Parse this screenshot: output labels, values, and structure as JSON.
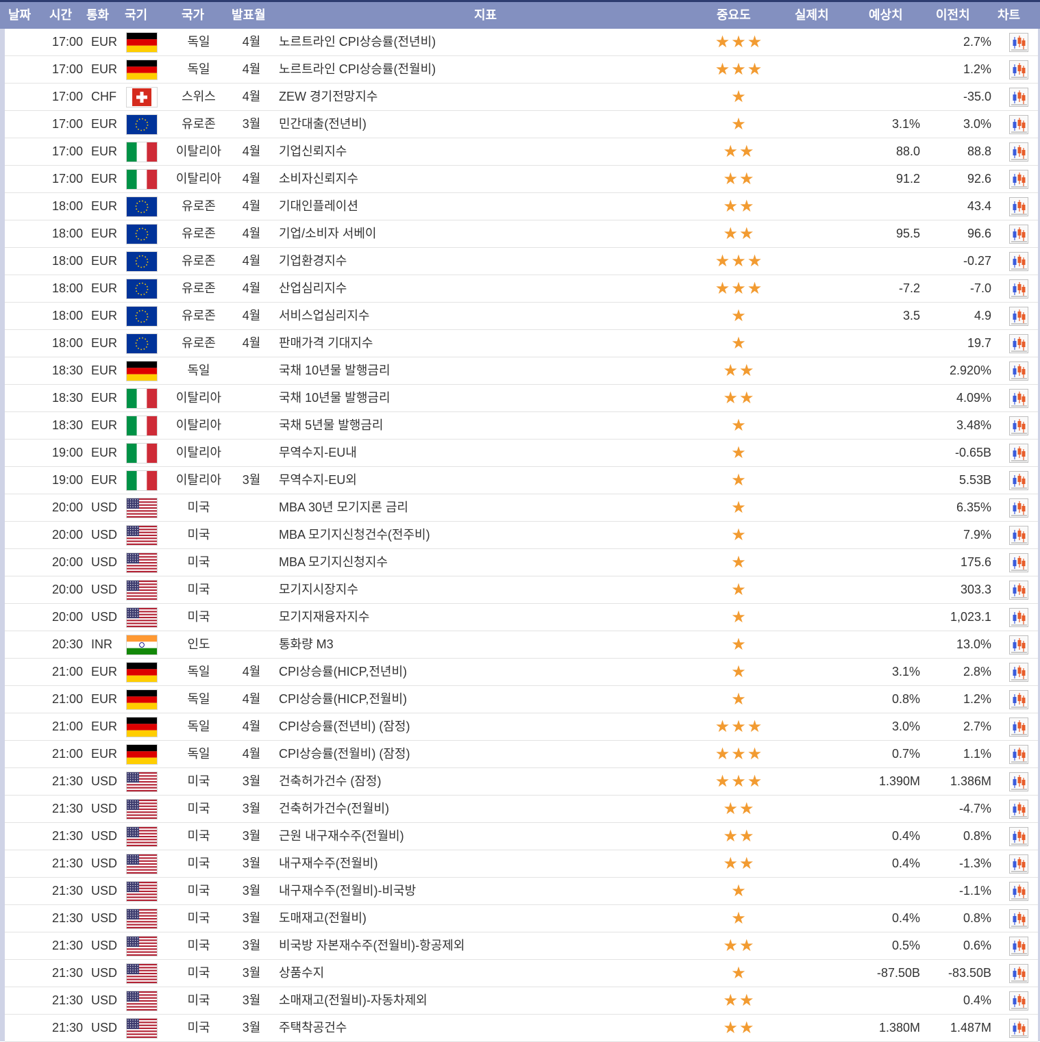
{
  "header": {
    "date": "날짜",
    "time": "시간",
    "currency": "통화",
    "flag": "국기",
    "country": "국가",
    "month": "발표월",
    "indicator": "지표",
    "importance": "중요도",
    "actual": "실제치",
    "forecast": "예상치",
    "previous": "이전치",
    "chart": "차트"
  },
  "colors": {
    "header_bg": "#8390c0",
    "header_rule": "#2d3c70",
    "star": "#f29b31",
    "row_border": "#e3e3e3"
  },
  "icons": {
    "importance": "star-icon",
    "chart": "candlestick-chart-icon"
  },
  "rows": [
    {
      "time": "17:00",
      "currency": "EUR",
      "flag": "de",
      "country": "독일",
      "month": "4월",
      "indicator": "노르트라인 CPI상승률(전년비)",
      "stars": "★★★",
      "actual": "",
      "forecast": "",
      "previous": "2.7%"
    },
    {
      "time": "17:00",
      "currency": "EUR",
      "flag": "de",
      "country": "독일",
      "month": "4월",
      "indicator": "노르트라인 CPI상승률(전월비)",
      "stars": "★★★",
      "actual": "",
      "forecast": "",
      "previous": "1.2%"
    },
    {
      "time": "17:00",
      "currency": "CHF",
      "flag": "ch",
      "country": "스위스",
      "month": "4월",
      "indicator": "ZEW 경기전망지수",
      "stars": "★",
      "actual": "",
      "forecast": "",
      "previous": "-35.0"
    },
    {
      "time": "17:00",
      "currency": "EUR",
      "flag": "eu",
      "country": "유로존",
      "month": "3월",
      "indicator": "민간대출(전년비)",
      "stars": "★",
      "actual": "",
      "forecast": "3.1%",
      "previous": "3.0%"
    },
    {
      "time": "17:00",
      "currency": "EUR",
      "flag": "it",
      "country": "이탈리아",
      "month": "4월",
      "indicator": "기업신뢰지수",
      "stars": "★★",
      "actual": "",
      "forecast": "88.0",
      "previous": "88.8"
    },
    {
      "time": "17:00",
      "currency": "EUR",
      "flag": "it",
      "country": "이탈리아",
      "month": "4월",
      "indicator": "소비자신뢰지수",
      "stars": "★★",
      "actual": "",
      "forecast": "91.2",
      "previous": "92.6"
    },
    {
      "time": "18:00",
      "currency": "EUR",
      "flag": "eu",
      "country": "유로존",
      "month": "4월",
      "indicator": "기대인플레이션",
      "stars": "★★",
      "actual": "",
      "forecast": "",
      "previous": "43.4"
    },
    {
      "time": "18:00",
      "currency": "EUR",
      "flag": "eu",
      "country": "유로존",
      "month": "4월",
      "indicator": "기업/소비자 서베이",
      "stars": "★★",
      "actual": "",
      "forecast": "95.5",
      "previous": "96.6"
    },
    {
      "time": "18:00",
      "currency": "EUR",
      "flag": "eu",
      "country": "유로존",
      "month": "4월",
      "indicator": "기업환경지수",
      "stars": "★★★",
      "actual": "",
      "forecast": "",
      "previous": "-0.27"
    },
    {
      "time": "18:00",
      "currency": "EUR",
      "flag": "eu",
      "country": "유로존",
      "month": "4월",
      "indicator": "산업심리지수",
      "stars": "★★★",
      "actual": "",
      "forecast": "-7.2",
      "previous": "-7.0"
    },
    {
      "time": "18:00",
      "currency": "EUR",
      "flag": "eu",
      "country": "유로존",
      "month": "4월",
      "indicator": "서비스업심리지수",
      "stars": "★",
      "actual": "",
      "forecast": "3.5",
      "previous": "4.9"
    },
    {
      "time": "18:00",
      "currency": "EUR",
      "flag": "eu",
      "country": "유로존",
      "month": "4월",
      "indicator": "판매가격 기대지수",
      "stars": "★",
      "actual": "",
      "forecast": "",
      "previous": "19.7"
    },
    {
      "time": "18:30",
      "currency": "EUR",
      "flag": "de",
      "country": "독일",
      "month": "",
      "indicator": "국채 10년물 발행금리",
      "stars": "★★",
      "actual": "",
      "forecast": "",
      "previous": "2.920%"
    },
    {
      "time": "18:30",
      "currency": "EUR",
      "flag": "it",
      "country": "이탈리아",
      "month": "",
      "indicator": "국채 10년물 발행금리",
      "stars": "★★",
      "actual": "",
      "forecast": "",
      "previous": "4.09%"
    },
    {
      "time": "18:30",
      "currency": "EUR",
      "flag": "it",
      "country": "이탈리아",
      "month": "",
      "indicator": "국채 5년물 발행금리",
      "stars": "★",
      "actual": "",
      "forecast": "",
      "previous": "3.48%"
    },
    {
      "time": "19:00",
      "currency": "EUR",
      "flag": "it",
      "country": "이탈리아",
      "month": "",
      "indicator": "무역수지-EU내",
      "stars": "★",
      "actual": "",
      "forecast": "",
      "previous": "-0.65B"
    },
    {
      "time": "19:00",
      "currency": "EUR",
      "flag": "it",
      "country": "이탈리아",
      "month": "3월",
      "indicator": "무역수지-EU외",
      "stars": "★",
      "actual": "",
      "forecast": "",
      "previous": "5.53B"
    },
    {
      "time": "20:00",
      "currency": "USD",
      "flag": "us",
      "country": "미국",
      "month": "",
      "indicator": "MBA 30년 모기지론 금리",
      "stars": "★",
      "actual": "",
      "forecast": "",
      "previous": "6.35%"
    },
    {
      "time": "20:00",
      "currency": "USD",
      "flag": "us",
      "country": "미국",
      "month": "",
      "indicator": "MBA 모기지신청건수(전주비)",
      "stars": "★",
      "actual": "",
      "forecast": "",
      "previous": "7.9%"
    },
    {
      "time": "20:00",
      "currency": "USD",
      "flag": "us",
      "country": "미국",
      "month": "",
      "indicator": "MBA 모기지신청지수",
      "stars": "★",
      "actual": "",
      "forecast": "",
      "previous": "175.6"
    },
    {
      "time": "20:00",
      "currency": "USD",
      "flag": "us",
      "country": "미국",
      "month": "",
      "indicator": "모기지시장지수",
      "stars": "★",
      "actual": "",
      "forecast": "",
      "previous": "303.3"
    },
    {
      "time": "20:00",
      "currency": "USD",
      "flag": "us",
      "country": "미국",
      "month": "",
      "indicator": "모기지재융자지수",
      "stars": "★",
      "actual": "",
      "forecast": "",
      "previous": "1,023.1"
    },
    {
      "time": "20:30",
      "currency": "INR",
      "flag": "in",
      "country": "인도",
      "month": "",
      "indicator": "통화량 M3",
      "stars": "★",
      "actual": "",
      "forecast": "",
      "previous": "13.0%"
    },
    {
      "time": "21:00",
      "currency": "EUR",
      "flag": "de",
      "country": "독일",
      "month": "4월",
      "indicator": "CPI상승률(HICP,전년비)",
      "stars": "★",
      "actual": "",
      "forecast": "3.1%",
      "previous": "2.8%"
    },
    {
      "time": "21:00",
      "currency": "EUR",
      "flag": "de",
      "country": "독일",
      "month": "4월",
      "indicator": "CPI상승률(HICP,전월비)",
      "stars": "★",
      "actual": "",
      "forecast": "0.8%",
      "previous": "1.2%"
    },
    {
      "time": "21:00",
      "currency": "EUR",
      "flag": "de",
      "country": "독일",
      "month": "4월",
      "indicator": "CPI상승률(전년비) (잠정)",
      "stars": "★★★",
      "actual": "",
      "forecast": "3.0%",
      "previous": "2.7%"
    },
    {
      "time": "21:00",
      "currency": "EUR",
      "flag": "de",
      "country": "독일",
      "month": "4월",
      "indicator": "CPI상승률(전월비) (잠정)",
      "stars": "★★★",
      "actual": "",
      "forecast": "0.7%",
      "previous": "1.1%"
    },
    {
      "time": "21:30",
      "currency": "USD",
      "flag": "us",
      "country": "미국",
      "month": "3월",
      "indicator": "건축허가건수 (잠정)",
      "stars": "★★★",
      "actual": "",
      "forecast": "1.390M",
      "previous": "1.386M"
    },
    {
      "time": "21:30",
      "currency": "USD",
      "flag": "us",
      "country": "미국",
      "month": "3월",
      "indicator": "건축허가건수(전월비)",
      "stars": "★★",
      "actual": "",
      "forecast": "",
      "previous": "-4.7%"
    },
    {
      "time": "21:30",
      "currency": "USD",
      "flag": "us",
      "country": "미국",
      "month": "3월",
      "indicator": "근원 내구재수주(전월비)",
      "stars": "★★",
      "actual": "",
      "forecast": "0.4%",
      "previous": "0.8%"
    },
    {
      "time": "21:30",
      "currency": "USD",
      "flag": "us",
      "country": "미국",
      "month": "3월",
      "indicator": "내구재수주(전월비)",
      "stars": "★★",
      "actual": "",
      "forecast": "0.4%",
      "previous": "-1.3%"
    },
    {
      "time": "21:30",
      "currency": "USD",
      "flag": "us",
      "country": "미국",
      "month": "3월",
      "indicator": "내구재수주(전월비)-비국방",
      "stars": "★",
      "actual": "",
      "forecast": "",
      "previous": "-1.1%"
    },
    {
      "time": "21:30",
      "currency": "USD",
      "flag": "us",
      "country": "미국",
      "month": "3월",
      "indicator": "도매재고(전월비)",
      "stars": "★",
      "actual": "",
      "forecast": "0.4%",
      "previous": "0.8%"
    },
    {
      "time": "21:30",
      "currency": "USD",
      "flag": "us",
      "country": "미국",
      "month": "3월",
      "indicator": "비국방 자본재수주(전월비)-항공제외",
      "stars": "★★",
      "actual": "",
      "forecast": "0.5%",
      "previous": "0.6%"
    },
    {
      "time": "21:30",
      "currency": "USD",
      "flag": "us",
      "country": "미국",
      "month": "3월",
      "indicator": "상품수지",
      "stars": "★",
      "actual": "",
      "forecast": "-87.50B",
      "previous": "-83.50B"
    },
    {
      "time": "21:30",
      "currency": "USD",
      "flag": "us",
      "country": "미국",
      "month": "3월",
      "indicator": "소매재고(전월비)-자동차제외",
      "stars": "★★",
      "actual": "",
      "forecast": "",
      "previous": "0.4%"
    },
    {
      "time": "21:30",
      "currency": "USD",
      "flag": "us",
      "country": "미국",
      "month": "3월",
      "indicator": "주택착공건수",
      "stars": "★★",
      "actual": "",
      "forecast": "1.380M",
      "previous": "1.487M"
    }
  ]
}
